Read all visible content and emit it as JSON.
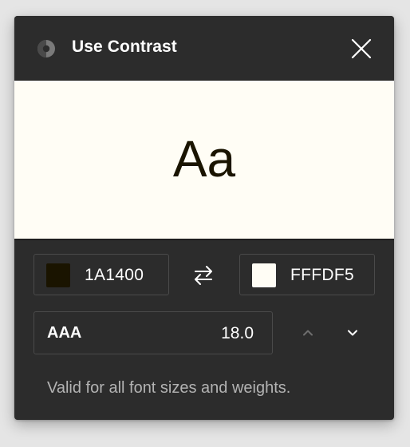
{
  "window": {
    "title": "Use Contrast",
    "app_icon": "contrast-logo-icon",
    "close_icon": "close-icon"
  },
  "preview": {
    "sample_text": "Aa"
  },
  "colors": {
    "foreground": {
      "hex": "1A1400",
      "swatch": "#1A1400"
    },
    "background": {
      "hex": "FFFDF5",
      "swatch": "#FFFDF5"
    },
    "swap_icon": "swap-arrows-icon"
  },
  "font_size": {
    "level": "AAA",
    "value": "18.0",
    "increment_icon": "chevron-up-icon",
    "decrement_icon": "chevron-down-icon"
  },
  "status": {
    "message": "Valid for all font sizes and weights."
  },
  "theme": {
    "panel": "#2c2c2c",
    "border": "#4a4a4a",
    "text": "#ffffff",
    "muted": "#b3b3b3"
  }
}
